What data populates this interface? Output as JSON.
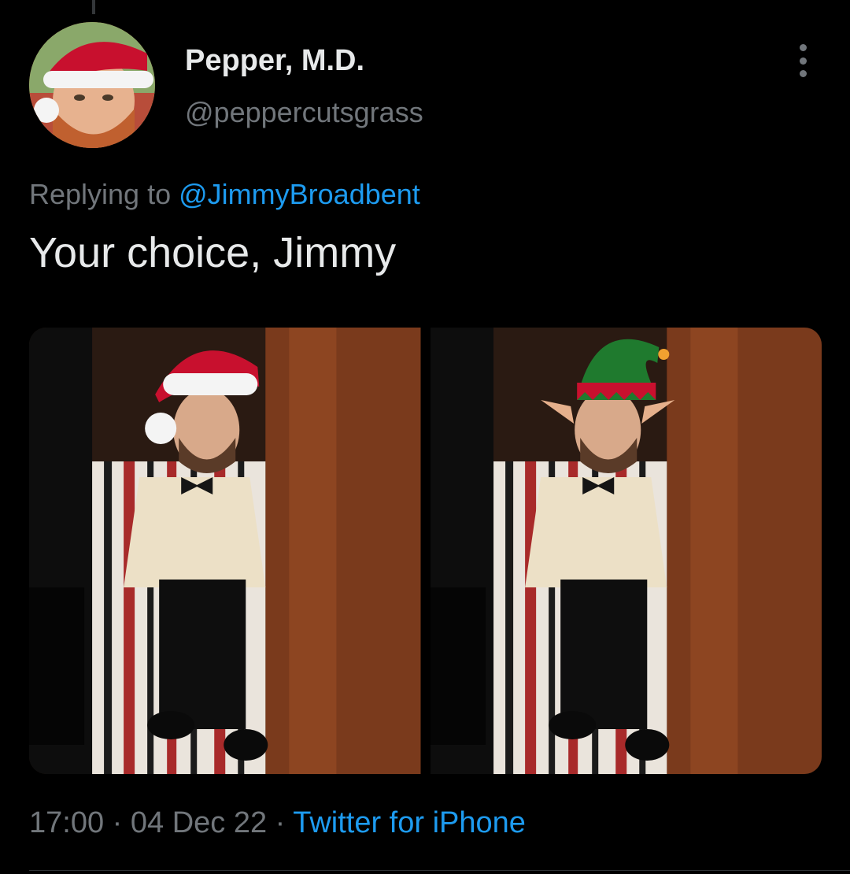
{
  "author": {
    "display_name": "Pepper, M.D.",
    "handle": "@peppercutsgrass",
    "avatar_icon": "profile-photo-santa-hat"
  },
  "reply_context": {
    "prefix": "Replying to",
    "mention": "@JimmyBroadbent"
  },
  "tweet": {
    "text": "Your choice, Jimmy",
    "media": [
      {
        "description_icon": "photo-santa-hat"
      },
      {
        "description_icon": "photo-elf-hat"
      }
    ]
  },
  "meta": {
    "time": "17:00",
    "separator": "·",
    "date": "04 Dec 22",
    "source": "Twitter for iPhone"
  },
  "colors": {
    "link": "#1d9bf0",
    "secondary_text": "#71767b",
    "primary_text": "#e7e9ea",
    "background": "#000000"
  }
}
